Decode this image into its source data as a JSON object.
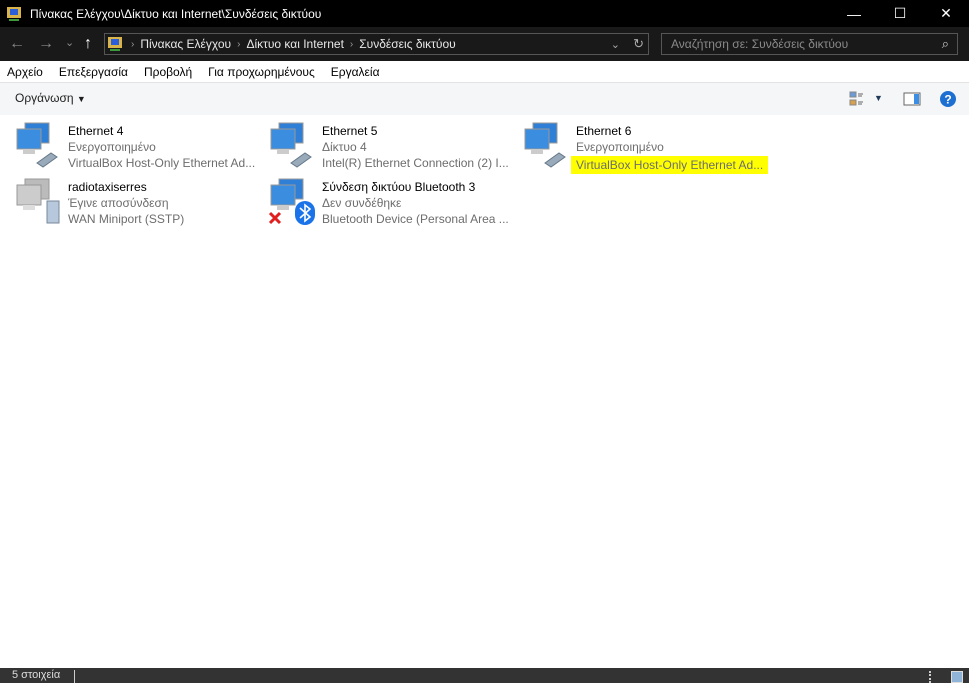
{
  "window": {
    "title": "Πίνακας Ελέγχου\\Δίκτυο και Internet\\Συνδέσεις δικτύου",
    "minimize": "—",
    "maximize": "☐",
    "close": "✕"
  },
  "nav": {
    "back": "←",
    "forward": "→",
    "recent": "⌄",
    "up": "↑",
    "breadcrumb": [
      "Πίνακας Ελέγχου",
      "Δίκτυο και Internet",
      "Συνδέσεις δικτύου"
    ],
    "search_placeholder": "Αναζήτηση σε: Συνδέσεις δικτύου"
  },
  "menu": [
    "Αρχείο",
    "Επεξεργασία",
    "Προβολή",
    "Για προχωρημένους",
    "Εργαλεία"
  ],
  "command": {
    "organize": "Οργάνωση"
  },
  "connections": [
    {
      "name": "Ethernet 4",
      "status": "Ενεργοποιημένο",
      "device": "VirtualBox Host-Only Ethernet Ad...",
      "icon": "ethernet-cable"
    },
    {
      "name": "Ethernet 5",
      "status": "Δίκτυο 4",
      "device": "Intel(R) Ethernet Connection (2) I...",
      "icon": "ethernet-cable"
    },
    {
      "name": "Ethernet 6",
      "status": "Ενεργοποιημένο",
      "device": "VirtualBox Host-Only Ethernet Ad...",
      "icon": "ethernet-cable",
      "highlighted": true
    },
    {
      "name": "radiotaxiserres",
      "status": "Έγινε αποσύνδεση",
      "device": "WAN Miniport (SSTP)",
      "icon": "wan-server"
    },
    {
      "name": "Σύνδεση δικτύου Bluetooth 3",
      "status": "Δεν συνδέθηκε",
      "device": "Bluetooth Device (Personal Area ...",
      "icon": "bluetooth"
    }
  ],
  "status_bar": {
    "count": "5 στοιχεία"
  },
  "colors": {
    "highlight": "#ffff00",
    "titlebar": "#000000",
    "navbar": "#191919"
  }
}
